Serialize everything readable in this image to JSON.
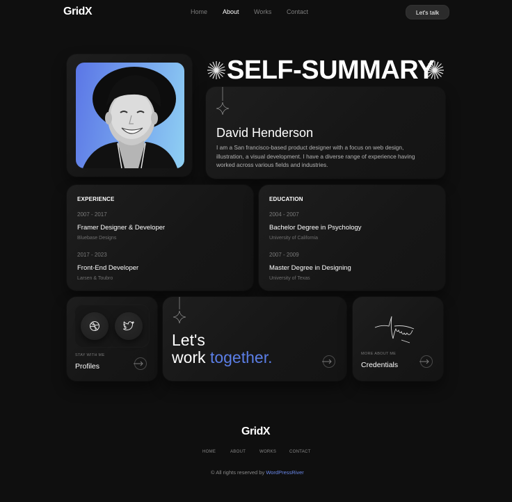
{
  "header": {
    "logo": "GridX",
    "nav": [
      {
        "label": "Home",
        "active": false
      },
      {
        "label": "About",
        "active": true
      },
      {
        "label": "Works",
        "active": false
      },
      {
        "label": "Contact",
        "active": false
      }
    ],
    "cta_label": "Let's talk"
  },
  "summary": {
    "title": "SELF-SUMMARY",
    "name": "David Henderson",
    "bio": "I am a San francisco-based product designer with a focus on web design, illustration, a visual development. I have a diverse range of experience having worked across various fields and industries."
  },
  "experience": {
    "heading": "EXPERIENCE",
    "items": [
      {
        "years": "2007 - 2017",
        "role": "Framer Designer & Developer",
        "org": "Bluebase Designs"
      },
      {
        "years": "2017 - 2023",
        "role": "Front-End Developer",
        "org": "Larsen & Toubro"
      }
    ]
  },
  "education": {
    "heading": "EDUCATION",
    "items": [
      {
        "years": "2004 - 2007",
        "role": "Bachelor Degree in Psychology",
        "org": "University of California"
      },
      {
        "years": "2007 - 2009",
        "role": "Master Degree in Designing",
        "org": "University of Texas"
      }
    ]
  },
  "profiles": {
    "small_label": "STAY WITH ME",
    "title": "Profiles",
    "icons": [
      "dribbble-icon",
      "twitter-icon"
    ]
  },
  "work_together": {
    "line1": "Let's",
    "line2_plain": "work ",
    "line2_accent": "together."
  },
  "credentials": {
    "small_label": "MORE ABOUT ME",
    "title": "Credentials"
  },
  "footer": {
    "logo": "GridX",
    "nav": [
      "HOME",
      "ABOUT",
      "WORKS",
      "CONTACT"
    ],
    "copyright_prefix": "© All rights reserved by ",
    "copyright_link": "WordPressRiver"
  },
  "colors": {
    "background": "#0f0f0f",
    "card": "#1a1a1a",
    "accent": "#5b7ee6",
    "muted_text": "#7a7a7a"
  }
}
